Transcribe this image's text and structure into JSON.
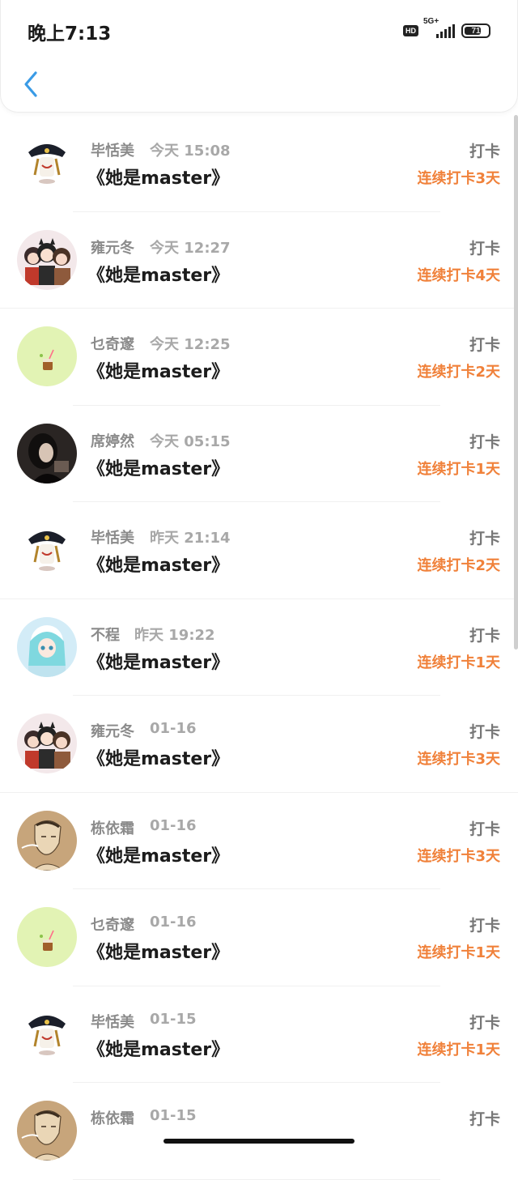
{
  "status": {
    "time": "晚上7:13",
    "hd": "HD",
    "network": "5G+",
    "battery": "71",
    "battery_level": 0.71
  },
  "header": {
    "back_icon": "chevron-left-icon"
  },
  "colors": {
    "accent_orange": "#f0813a",
    "back_blue": "#3a9be6"
  },
  "records": [
    {
      "name": "毕恬美",
      "time": "今天 15:08",
      "book": "《她是master》",
      "checkin": "打卡",
      "streak": "连续打卡3天",
      "avatar": "pirate"
    },
    {
      "name": "雍元冬",
      "time": "今天 12:27",
      "book": "《她是master》",
      "checkin": "打卡",
      "streak": "连续打卡4天",
      "avatar": "group"
    },
    {
      "name": "乜奇邃",
      "time": "今天 12:25",
      "book": "《她是master》",
      "checkin": "打卡",
      "streak": "连续打卡2天",
      "avatar": "drink"
    },
    {
      "name": "席婷然",
      "time": "今天 05:15",
      "book": "《她是master》",
      "checkin": "打卡",
      "streak": "连续打卡1天",
      "avatar": "dark"
    },
    {
      "name": "毕恬美",
      "time": "昨天 21:14",
      "book": "《她是master》",
      "checkin": "打卡",
      "streak": "连续打卡2天",
      "avatar": "pirate"
    },
    {
      "name": "不程",
      "time": "昨天 19:22",
      "book": "《她是master》",
      "checkin": "打卡",
      "streak": "连续打卡1天",
      "avatar": "anime"
    },
    {
      "name": "雍元冬",
      "time": "01-16",
      "book": "《她是master》",
      "checkin": "打卡",
      "streak": "连续打卡3天",
      "avatar": "group"
    },
    {
      "name": "栋依霜",
      "time": "01-16",
      "book": "《她是master》",
      "checkin": "打卡",
      "streak": "连续打卡3天",
      "avatar": "sketch"
    },
    {
      "name": "乜奇邃",
      "time": "01-16",
      "book": "《她是master》",
      "checkin": "打卡",
      "streak": "连续打卡1天",
      "avatar": "drink"
    },
    {
      "name": "毕恬美",
      "time": "01-15",
      "book": "《她是master》",
      "checkin": "打卡",
      "streak": "连续打卡1天",
      "avatar": "pirate"
    },
    {
      "name": "栋依霜",
      "time": "01-15",
      "book": "",
      "checkin": "打卡",
      "streak": "",
      "avatar": "sketch"
    }
  ]
}
